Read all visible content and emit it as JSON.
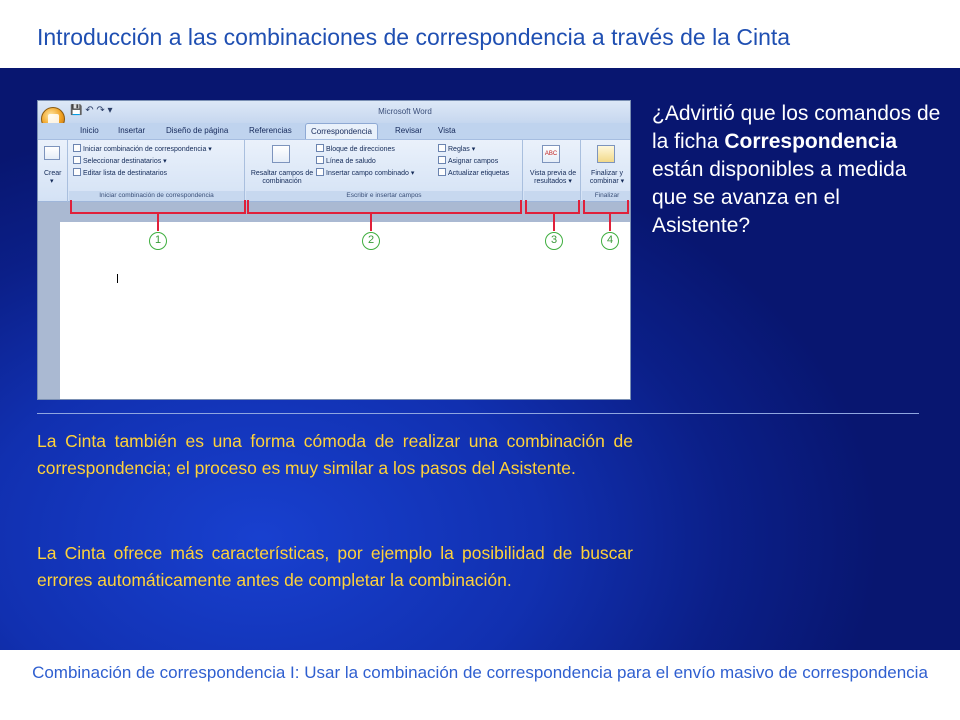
{
  "title": "Introducción a las combinaciones de correspondencia a través de la Cinta",
  "screenshot": {
    "app_title": "Microsoft Word",
    "qat": "💾 ↶ ↷ ▾",
    "tabs": [
      "Inicio",
      "Insertar",
      "Diseño de página",
      "Referencias",
      "Correspondencia",
      "Revisar",
      "Vista"
    ],
    "active_tab": "Correspondencia",
    "groups": {
      "crear": {
        "label": "",
        "button": "Crear"
      },
      "iniciar": {
        "label": "Iniciar combinación de correspondencia",
        "items": [
          "Iniciar combinación de correspondencia ▾",
          "Seleccionar destinatarios ▾",
          "Editar lista de destinatarios"
        ]
      },
      "escribir": {
        "label": "Escribir e insertar campos",
        "big_button": "Resaltar campos de combinación",
        "items_col1": [
          "Bloque de direcciones",
          "Línea de saludo",
          "Insertar campo combinado ▾"
        ],
        "items_col2": [
          "Reglas ▾",
          "Asignar campos",
          "Actualizar etiquetas"
        ]
      },
      "vista": {
        "label": "",
        "button": "Vista previa de resultados ▾",
        "icon_text": "ABC"
      },
      "finalizar": {
        "label": "Finalizar",
        "button": "Finalizar y combinar ▾"
      }
    },
    "callouts": [
      "1",
      "2",
      "3",
      "4"
    ]
  },
  "question": {
    "before": "¿Advirtió que los comandos de la ficha ",
    "bold": "Correspondencia",
    "after": " están disponibles a medida que se avanza en el Asistente?"
  },
  "paragraphs": [
    "La Cinta también es una forma cómoda de realizar una combinación de correspondencia; el proceso es muy similar a los pasos del Asistente.",
    "La Cinta ofrece más características, por ejemplo la posibilidad de buscar errores automáticamente antes de completar la combinación."
  ],
  "footer": "Combinación de correspondencia I: Usar la combinación de correspondencia para el envío masivo de correspondencia",
  "colors": {
    "title": "#1f4fb2",
    "background": "#1130b0",
    "body_text": "#ffd23a",
    "question_text": "#ffffff",
    "callout_line": "#e0203a",
    "callout_circle": "#3fae3f",
    "footer_text": "#2f5fd0"
  }
}
